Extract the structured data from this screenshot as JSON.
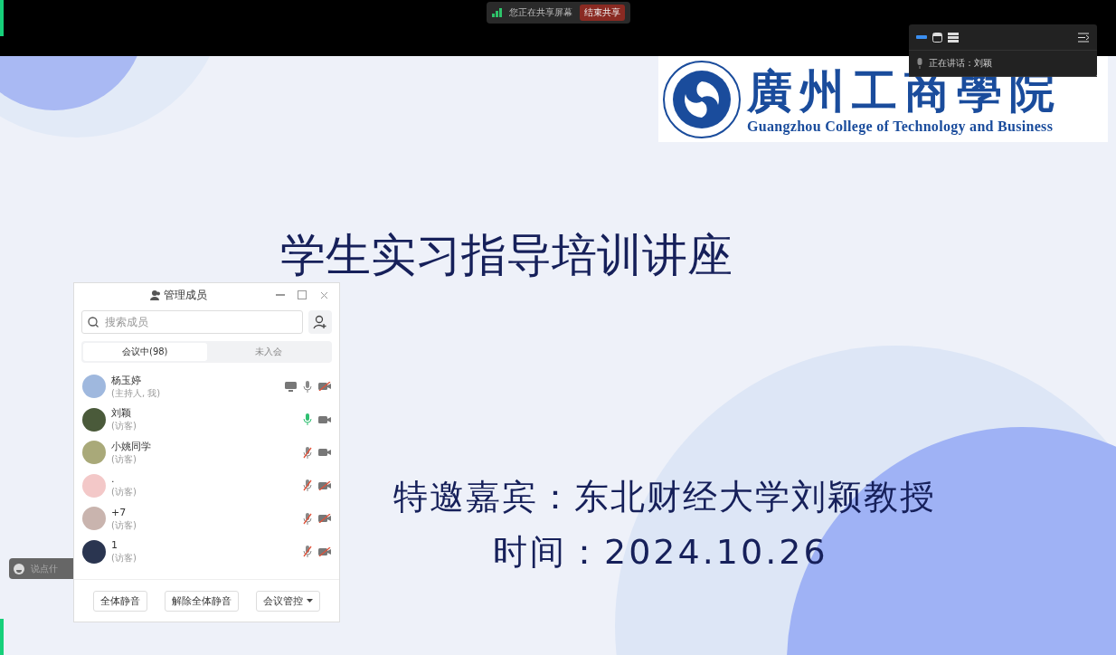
{
  "share_bar": {
    "status": "您正在共享屏幕",
    "stop_button": "结束共享"
  },
  "speaker_panel": {
    "speaking": "正在讲话：刘颖"
  },
  "slide": {
    "logo_cn": "廣州工商學院",
    "logo_en": "Guangzhou College of Technology and Business",
    "title": "学生实习指导培训讲座",
    "guest": "特邀嘉宾：东北财经大学刘颖教授",
    "time": "时间：2024.10.26"
  },
  "chat": {
    "placeholder": "说点什"
  },
  "members_panel": {
    "title": "管理成员",
    "search": {
      "placeholder": "搜索成员"
    },
    "tabs": [
      {
        "label": "会议中(98)",
        "selected": true
      },
      {
        "label": "未入会",
        "selected": false
      }
    ],
    "members": [
      {
        "name": "杨玉婷",
        "role": "(主持人, 我)",
        "sharing": true,
        "mic_muted": false,
        "speaking": false,
        "camera": false,
        "color": "#9fb8de"
      },
      {
        "name": "刘颖",
        "role": "(访客)",
        "sharing": false,
        "mic_muted": false,
        "speaking": true,
        "camera": true,
        "color": "#4a5a3a"
      },
      {
        "name": "小姚同学",
        "role": "(访客)",
        "sharing": false,
        "mic_muted": true,
        "speaking": false,
        "camera": true,
        "color": "#a9a979"
      },
      {
        "name": ".",
        "role": "(访客)",
        "sharing": false,
        "mic_muted": true,
        "speaking": false,
        "camera": false,
        "color": "#f3c8c8"
      },
      {
        "name": "+7",
        "role": "(访客)",
        "sharing": false,
        "mic_muted": true,
        "speaking": false,
        "camera": false,
        "color": "#c9b4ae"
      },
      {
        "name": "1",
        "role": "(访客)",
        "sharing": false,
        "mic_muted": true,
        "speaking": false,
        "camera": false,
        "color": "#2a3550"
      }
    ],
    "buttons": [
      {
        "label": "全体静音",
        "kind": "plain"
      },
      {
        "label": "解除全体静音",
        "kind": "plain"
      },
      {
        "label": "会议管控",
        "kind": "dropdown"
      }
    ]
  }
}
